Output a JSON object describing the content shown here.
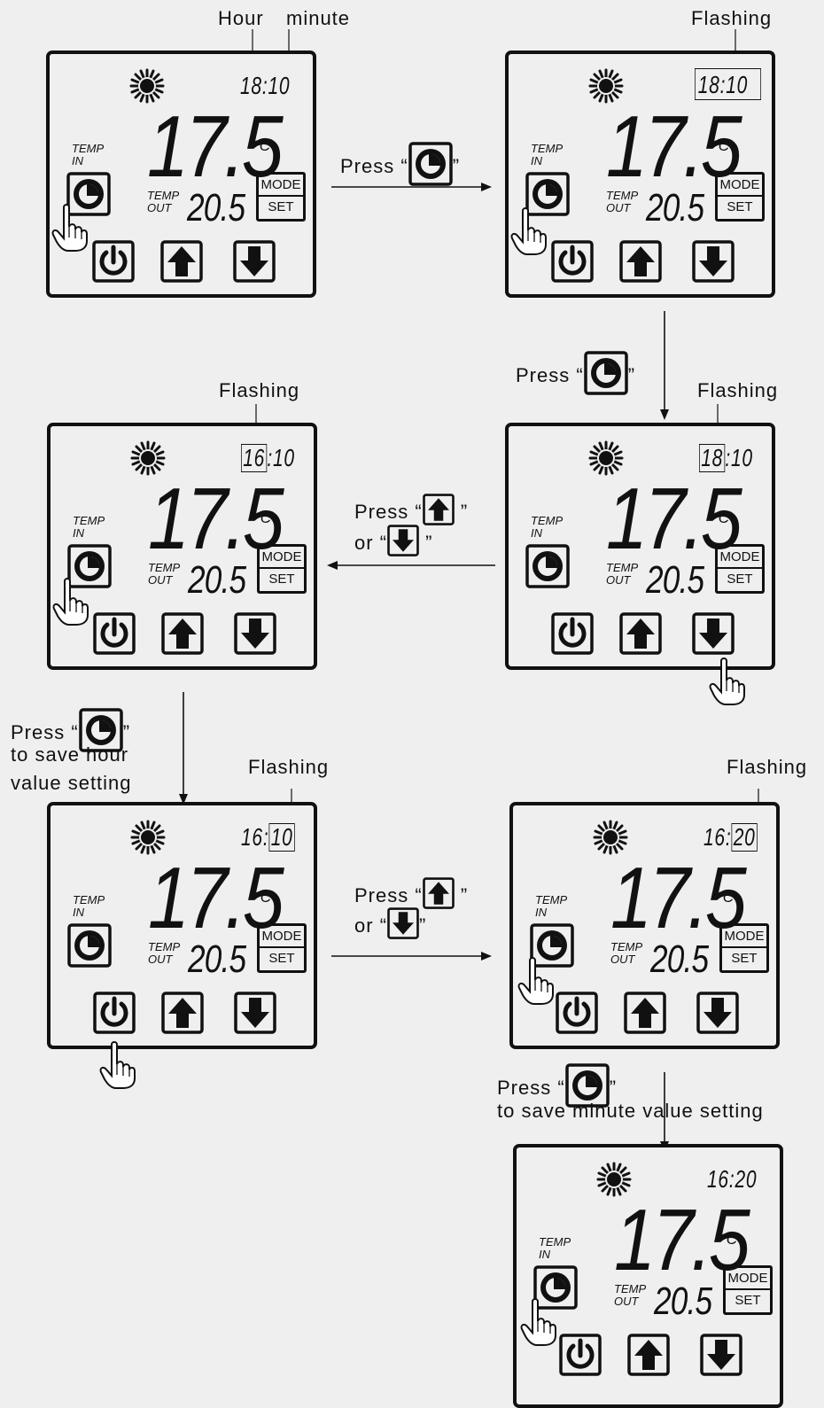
{
  "labels": {
    "hour": "Hour",
    "minute": "minute",
    "flashing": "Flashing",
    "press": "Press",
    "or": "or",
    "save_hour_1": "to save hour",
    "save_hour_2": "value setting",
    "save_minute": "to save minute value setting",
    "open_quote": "“",
    "close_quote": "”"
  },
  "display": {
    "temp_in_1": "TEMP",
    "temp_in_2": "IN",
    "temp_out_1": "TEMP",
    "temp_out_2": "OUT",
    "temp_big": "17.5",
    "temp_small": "20.5",
    "unit": "°C",
    "mode": "MODE",
    "set": "SET",
    "colon": ":"
  },
  "panels": [
    {
      "hour": "18",
      "minute": "10",
      "flashing": "none"
    },
    {
      "hour": "18",
      "minute": "10",
      "flashing": "both"
    },
    {
      "hour": "18",
      "minute": "10",
      "flashing": "hour"
    },
    {
      "hour": "16",
      "minute": "10",
      "flashing": "hour"
    },
    {
      "hour": "16",
      "minute": "10",
      "flashing": "minute"
    },
    {
      "hour": "16",
      "minute": "20",
      "flashing": "minute"
    },
    {
      "hour": "16",
      "minute": "20",
      "flashing": "none"
    }
  ],
  "icons": [
    "sun-icon",
    "clock-icon",
    "power-icon",
    "up-arrow-icon",
    "down-arrow-icon",
    "pointing-hand-icon"
  ]
}
